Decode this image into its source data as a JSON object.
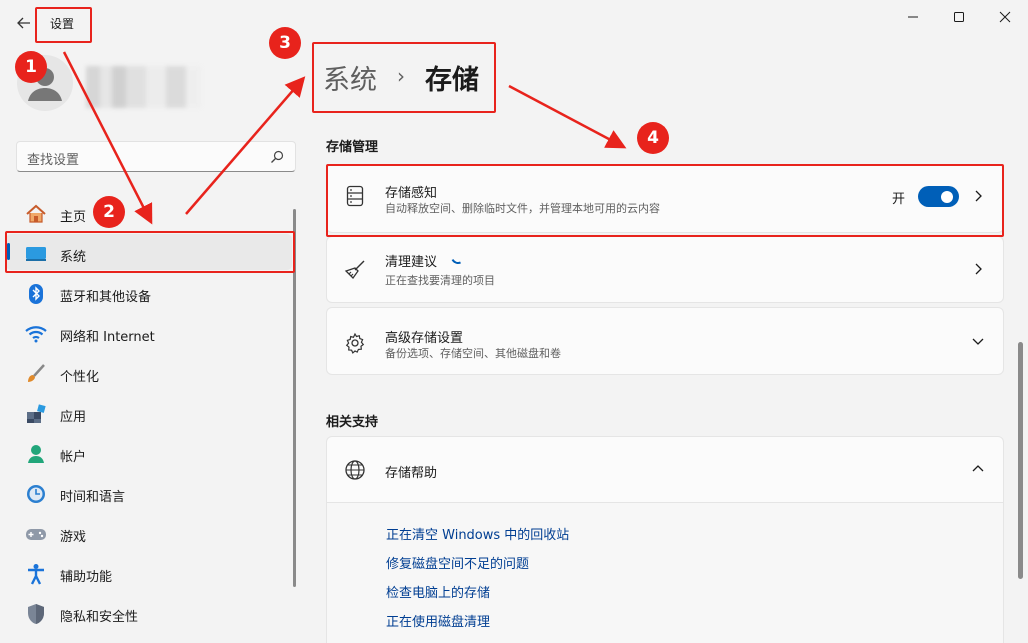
{
  "window": {
    "title": "设置",
    "controls": [
      "minimize",
      "maximize",
      "close"
    ]
  },
  "search": {
    "placeholder": "查找设置"
  },
  "sidebar": {
    "items": [
      {
        "label": "主页",
        "icon": "home-icon"
      },
      {
        "label": "系统",
        "icon": "system-icon",
        "active": true
      },
      {
        "label": "蓝牙和其他设备",
        "icon": "bluetooth-icon"
      },
      {
        "label": "网络和 Internet",
        "icon": "wifi-icon"
      },
      {
        "label": "个性化",
        "icon": "brush-icon"
      },
      {
        "label": "应用",
        "icon": "apps-icon"
      },
      {
        "label": "帐户",
        "icon": "account-icon"
      },
      {
        "label": "时间和语言",
        "icon": "time-language-icon"
      },
      {
        "label": "游戏",
        "icon": "gaming-icon"
      },
      {
        "label": "辅助功能",
        "icon": "accessibility-icon"
      },
      {
        "label": "隐私和安全性",
        "icon": "shield-icon"
      }
    ]
  },
  "breadcrumb": {
    "parent": "系统",
    "separator": "›",
    "current": "存储"
  },
  "storage_management": {
    "heading": "存储管理",
    "storage_sense": {
      "title": "存储感知",
      "subtitle": "自动释放空间、删除临时文件，并管理本地可用的云内容",
      "toggle_label": "开",
      "toggle_on": true
    },
    "cleanup": {
      "title": "清理建议",
      "subtitle": "正在查找要清理的项目"
    },
    "advanced": {
      "title": "高级存储设置",
      "subtitle": "备份选项、存储空间、其他磁盘和卷"
    }
  },
  "related_support": {
    "heading": "相关支持",
    "help": {
      "title": "存储帮助"
    },
    "links": [
      "正在清空 Windows 中的回收站",
      "修复磁盘空间不足的问题",
      "检查电脑上的存储",
      "正在使用磁盘清理"
    ]
  },
  "annotations": {
    "badges": [
      "1",
      "2",
      "3",
      "4"
    ]
  },
  "colors": {
    "accent": "#005fb8",
    "annotation_red": "#e8231c",
    "link": "#003e92"
  }
}
